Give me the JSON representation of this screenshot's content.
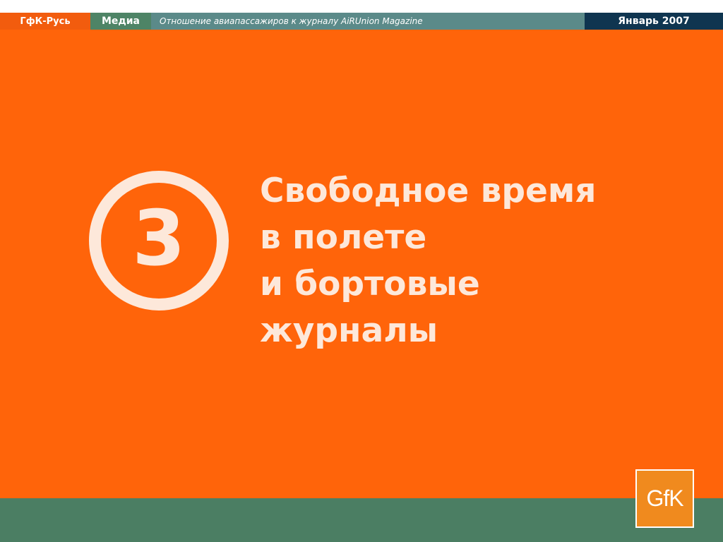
{
  "header": {
    "org": "ГфК-Русь",
    "section": "Медиа",
    "report_title": "Отношение авиапассажиров к журналу AiRUnion Magazine",
    "date": "Январь 2007"
  },
  "chapter": {
    "number": "3",
    "title_lines": [
      "Свободное время",
      "в полете",
      "и бортовые",
      "журналы"
    ]
  },
  "logo": {
    "text": "GfK"
  },
  "colors": {
    "main_background": "#ff640a",
    "accent_text": "#fde8da",
    "org_tab": "#f25c0e",
    "section_tab": "#4e8466",
    "report_bar": "#5b8a89",
    "date_tab": "#0f3550",
    "footer_band": "#4b7e63",
    "logo_background": "#f08a1e"
  }
}
